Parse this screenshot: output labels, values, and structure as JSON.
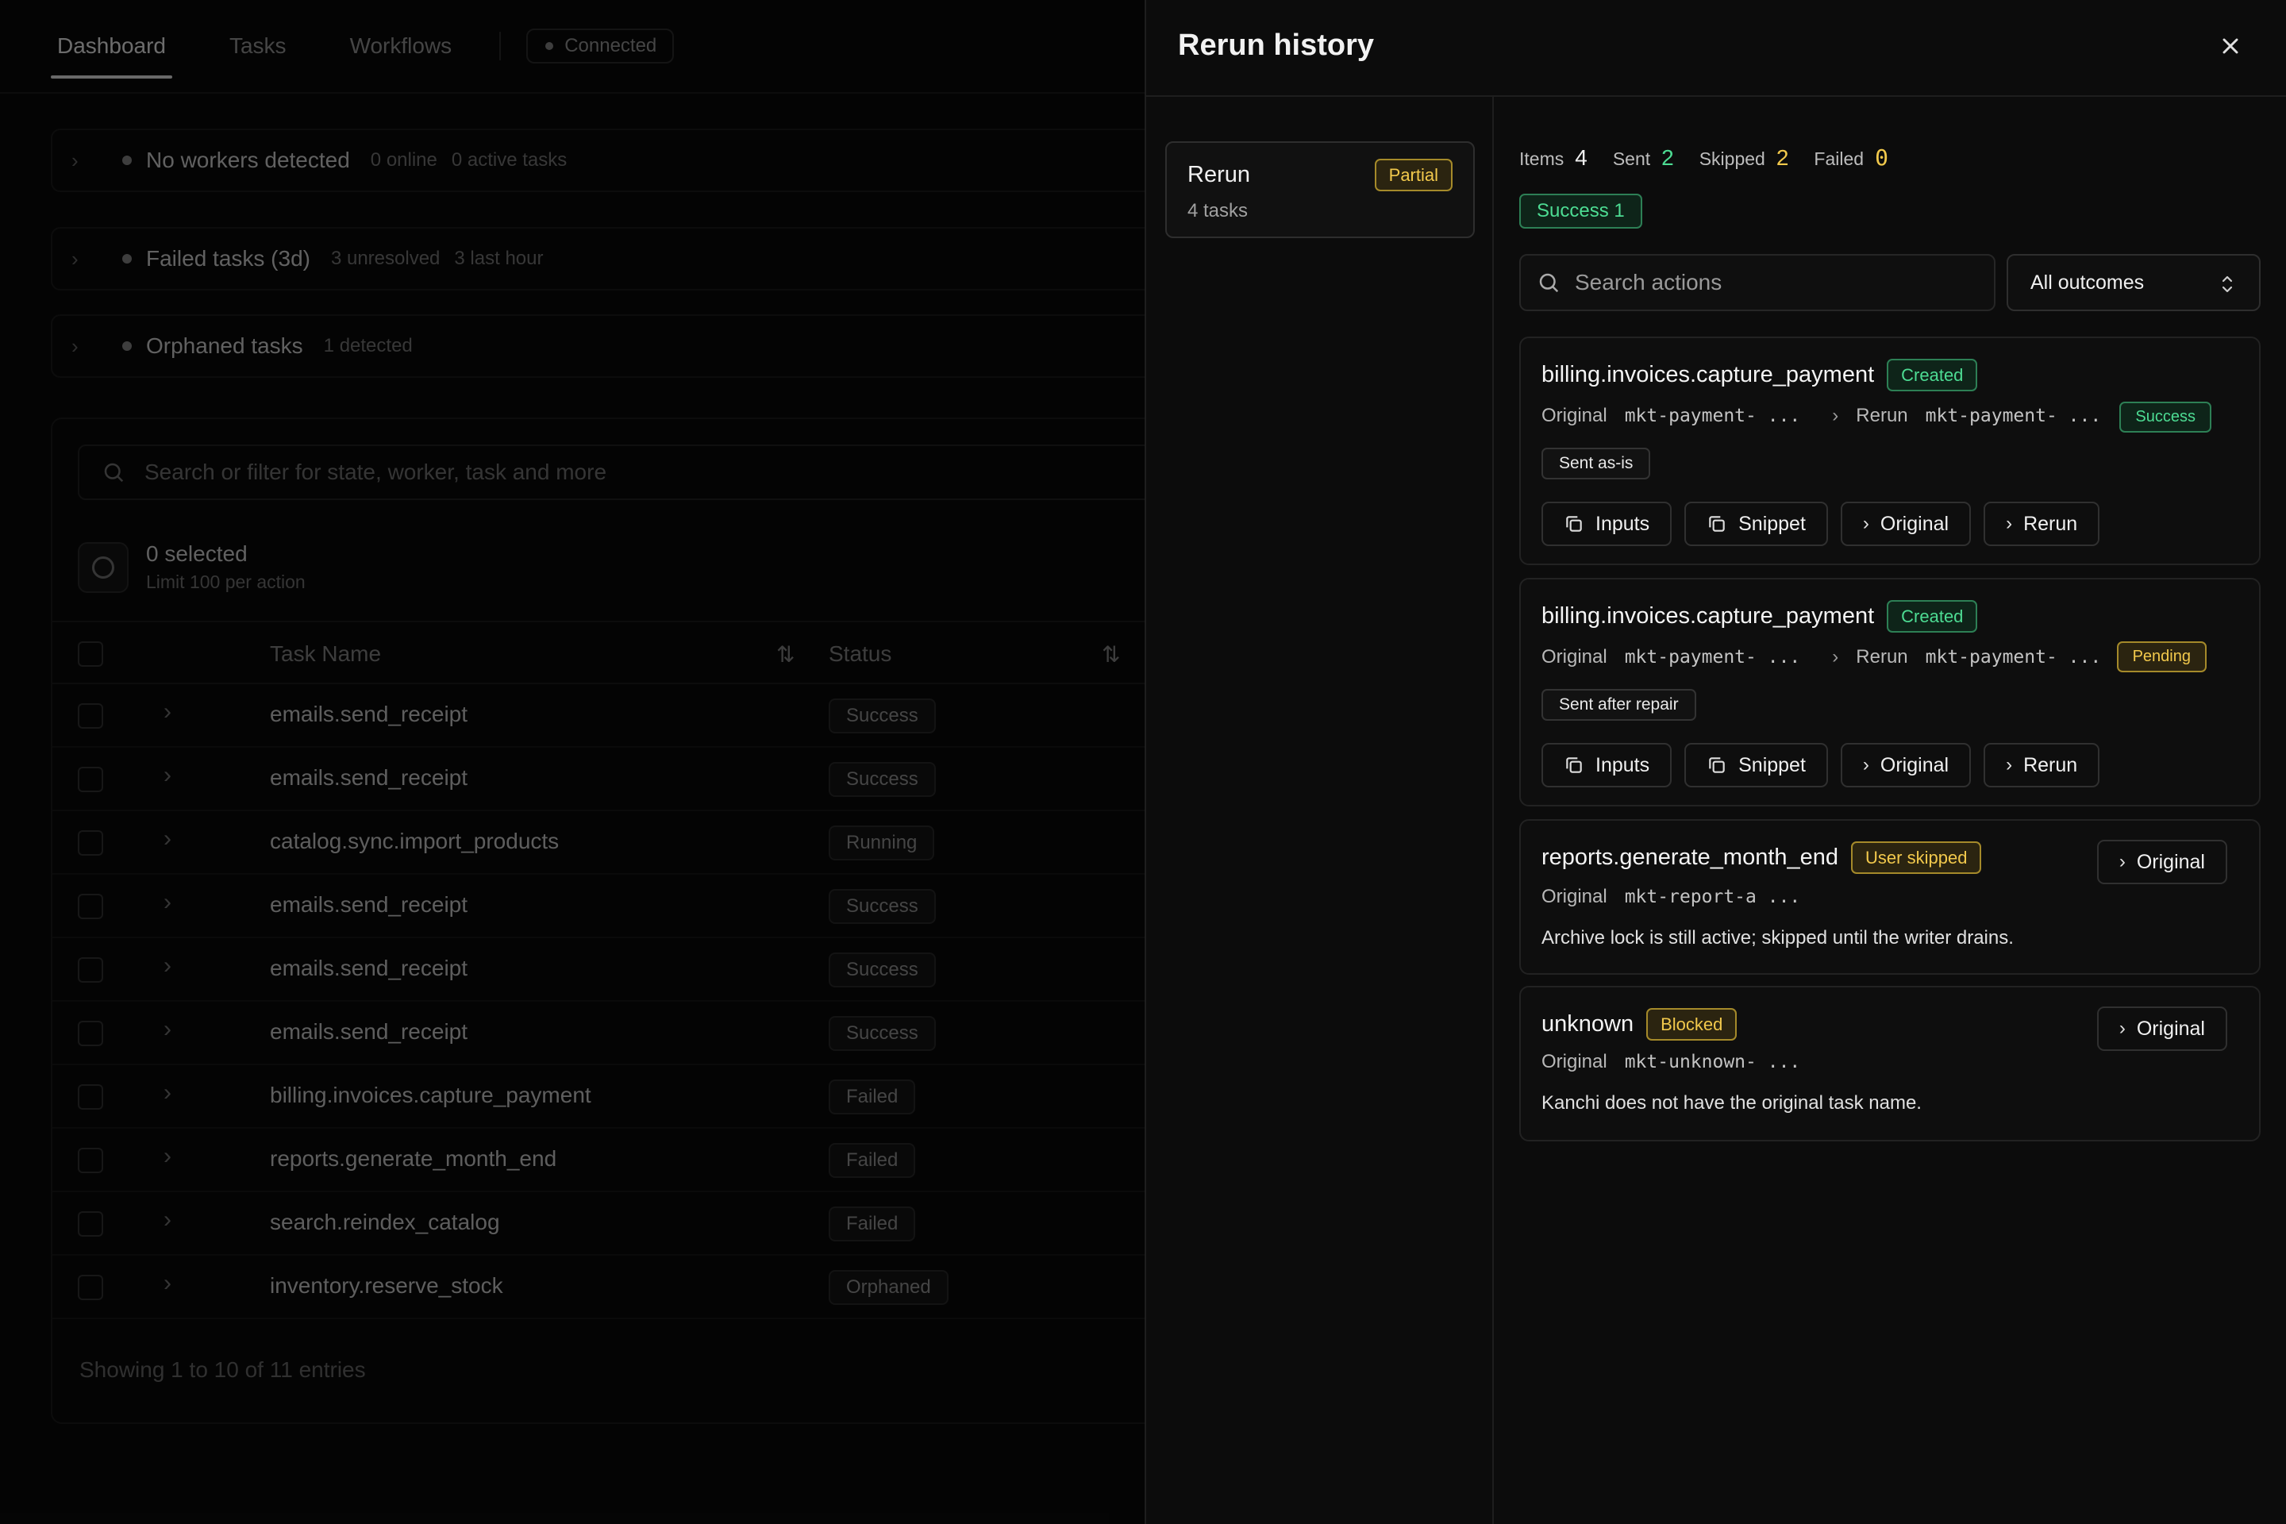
{
  "nav": {
    "tabs": [
      "Dashboard",
      "Tasks",
      "Workflows"
    ],
    "connection": "Connected"
  },
  "alerts": [
    {
      "title": "No workers detected",
      "meta1": "0 online",
      "meta2": "0 active tasks"
    },
    {
      "title": "Failed tasks (3d)",
      "meta1": "3 unresolved",
      "meta2": "3 last hour"
    },
    {
      "title": "Orphaned tasks",
      "meta1": "1 detected",
      "meta2": ""
    }
  ],
  "table": {
    "search_placeholder": "Search or filter for state, worker, task and more",
    "selected": "0 selected",
    "limit": "Limit 100 per action",
    "columns": [
      "Task Name",
      "Status"
    ],
    "rows": [
      {
        "name": "emails.send_receipt",
        "status": "Success"
      },
      {
        "name": "emails.send_receipt",
        "status": "Success"
      },
      {
        "name": "catalog.sync.import_products",
        "status": "Running"
      },
      {
        "name": "emails.send_receipt",
        "status": "Success"
      },
      {
        "name": "emails.send_receipt",
        "status": "Success"
      },
      {
        "name": "emails.send_receipt",
        "status": "Success"
      },
      {
        "name": "billing.invoices.capture_payment",
        "status": "Failed"
      },
      {
        "name": "reports.generate_month_end",
        "status": "Failed"
      },
      {
        "name": "search.reindex_catalog",
        "status": "Failed"
      },
      {
        "name": "inventory.reserve_stock",
        "status": "Orphaned"
      }
    ],
    "footer": "Showing 1 to 10 of 11 entries"
  },
  "panel": {
    "title": "Rerun history",
    "run": {
      "title": "Rerun",
      "subtitle": "4 tasks",
      "badge": "Partial"
    },
    "stats": {
      "items_label": "Items",
      "items": "4",
      "sent_label": "Sent",
      "sent": "2",
      "skipped_label": "Skipped",
      "skipped": "2",
      "failed_label": "Failed",
      "failed": "0"
    },
    "success_pill": "Success 1",
    "search_placeholder": "Search actions",
    "filter": "All outcomes",
    "items": [
      {
        "name": "billing.invoices.capture_payment",
        "badge": "Created",
        "original_label": "Original",
        "original_id": "mkt-payment- ...",
        "rerun_label": "Rerun",
        "rerun_id": "mkt-payment- ...",
        "status": "Success",
        "note": "Sent as-is",
        "buttons": [
          "Inputs",
          "Snippet",
          "Original",
          "Rerun"
        ]
      },
      {
        "name": "billing.invoices.capture_payment",
        "badge": "Created",
        "original_label": "Original",
        "original_id": "mkt-payment- ...",
        "rerun_label": "Rerun",
        "rerun_id": "mkt-payment- ...",
        "status": "Pending",
        "note": "Sent after repair",
        "buttons": [
          "Inputs",
          "Snippet",
          "Original",
          "Rerun"
        ]
      },
      {
        "name": "reports.generate_month_end",
        "badge": "User skipped",
        "original_label": "Original",
        "original_id": "mkt-report-a ...",
        "description": "Archive lock is still active; skipped until the writer drains.",
        "button": "Original"
      },
      {
        "name": "unknown",
        "badge": "Blocked",
        "original_label": "Original",
        "original_id": "mkt-unknown- ...",
        "description": "Kanchi does not have the original task name.",
        "button": "Original"
      }
    ]
  },
  "colors": {
    "green": "#4ddc93",
    "yellow": "#f2c94c",
    "panel_bg": "#0c0c0c"
  }
}
